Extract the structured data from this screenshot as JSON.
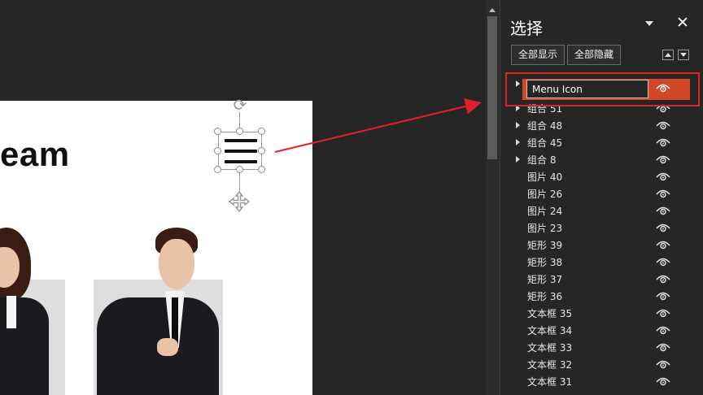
{
  "slide": {
    "title_partial": "eam"
  },
  "selection_pane": {
    "title": "选择",
    "show_all_label": "全部显示",
    "hide_all_label": "全部隐藏",
    "editing_value": "Menu Icon",
    "items": [
      {
        "label": "组合 51",
        "expandable": true
      },
      {
        "label": "组合 48",
        "expandable": true
      },
      {
        "label": "组合 45",
        "expandable": true
      },
      {
        "label": "组合 8",
        "expandable": true
      },
      {
        "label": "图片 40",
        "expandable": false
      },
      {
        "label": "图片 26",
        "expandable": false
      },
      {
        "label": "图片 24",
        "expandable": false
      },
      {
        "label": "图片 23",
        "expandable": false
      },
      {
        "label": "矩形 39",
        "expandable": false
      },
      {
        "label": "矩形 38",
        "expandable": false
      },
      {
        "label": "矩形 37",
        "expandable": false
      },
      {
        "label": "矩形 36",
        "expandable": false
      },
      {
        "label": "文本框 35",
        "expandable": false
      },
      {
        "label": "文本框 34",
        "expandable": false
      },
      {
        "label": "文本框 33",
        "expandable": false
      },
      {
        "label": "文本框 32",
        "expandable": false
      },
      {
        "label": "文本框 31",
        "expandable": false
      }
    ]
  },
  "colors": {
    "background": "#262626",
    "selected_row": "#d24726",
    "annotation_red": "#e0202a"
  },
  "icons": {
    "close": "close-icon",
    "pane_menu": "chevron-down-icon",
    "visibility": "eye-icon",
    "rotate": "rotate-handle-icon",
    "move": "move-handle-icon",
    "menu": "hamburger-icon"
  }
}
